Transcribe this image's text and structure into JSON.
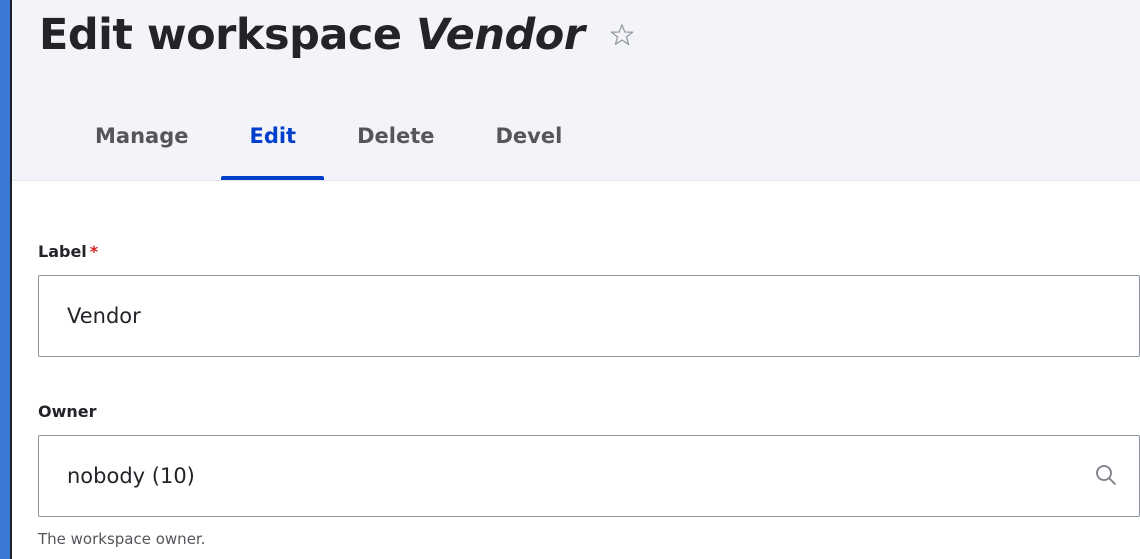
{
  "header": {
    "title_prefix": "Edit workspace",
    "title_name": "Vendor"
  },
  "tabs": [
    {
      "label": "Manage",
      "active": false
    },
    {
      "label": "Edit",
      "active": true
    },
    {
      "label": "Delete",
      "active": false
    },
    {
      "label": "Devel",
      "active": false
    }
  ],
  "form": {
    "label_field": {
      "label": "Label",
      "required_mark": "*",
      "value": "Vendor"
    },
    "owner_field": {
      "label": "Owner",
      "value": "nobody (10)",
      "description": "The workspace owner."
    }
  },
  "icons": {
    "favorite": "star-outline-icon",
    "autocomplete": "search-icon"
  },
  "colors": {
    "background_accent": "#3a78d8",
    "active_tab": "#003ecc",
    "required": "#d72222",
    "header_bg": "#f3f4f9"
  }
}
